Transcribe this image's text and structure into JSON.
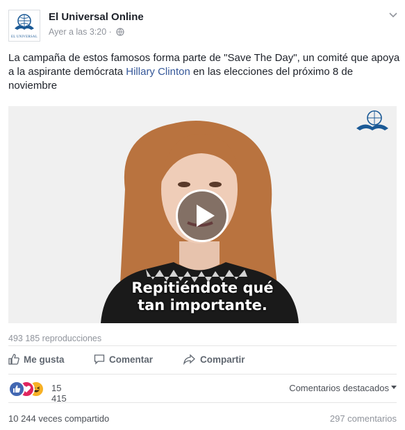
{
  "post": {
    "page_name": "El Universal Online",
    "timestamp": "Ayer a las 3:20 ·",
    "logo_text": "EL UNIVERSAL",
    "text_before": "La campaña de estos famosos forma parte de \"Save The Day\", un comité que apoya a la aspirante demócrata ",
    "text_link": "Hillary Clinton",
    "text_after": " en las elecciones del próximo 8 de noviembre"
  },
  "video": {
    "caption_line1": "Repitiéndote qué",
    "caption_line2": "tan importante.",
    "views": "493 185 reproducciones"
  },
  "actions": {
    "like": "Me gusta",
    "comment": "Comentar",
    "share": "Compartir"
  },
  "stats": {
    "reactions_count": "15 415",
    "featured_comments": "Comentarios destacados",
    "shares": "10 244 veces compartido",
    "comments": "297 comentarios"
  },
  "colors": {
    "link": "#365899",
    "like_reaction": "#4267b2",
    "love_reaction": "#e0245e",
    "haha_reaction": "#f7b125"
  },
  "icons": [
    "globe-icon",
    "chevron-down-icon",
    "play-icon",
    "thumbs-up-icon",
    "comment-icon",
    "share-arrow-icon",
    "like-reaction-icon",
    "love-reaction-icon",
    "haha-reaction-icon"
  ]
}
